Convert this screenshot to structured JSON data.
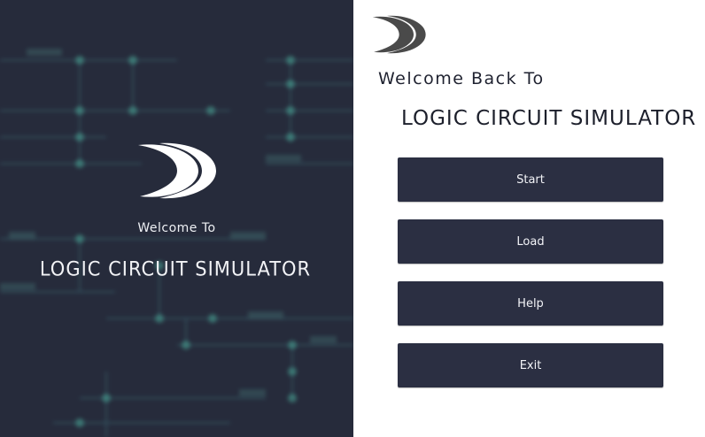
{
  "left": {
    "welcome": "Welcome To",
    "title": "LOGIC CIRCUIT SIMULATOR"
  },
  "right": {
    "welcome": "Welcome Back To",
    "title": "LOGIC CIRCUIT SIMULATOR"
  },
  "menu": {
    "start": "Start",
    "load": "Load",
    "help": "Help",
    "exit": "Exit"
  },
  "colors": {
    "dark_panel": "#262b3b",
    "button_bg": "#2b2f42",
    "circuit_accent": "#4fb7a3"
  },
  "icons": {
    "logo": "double-crescent-logo-icon"
  }
}
